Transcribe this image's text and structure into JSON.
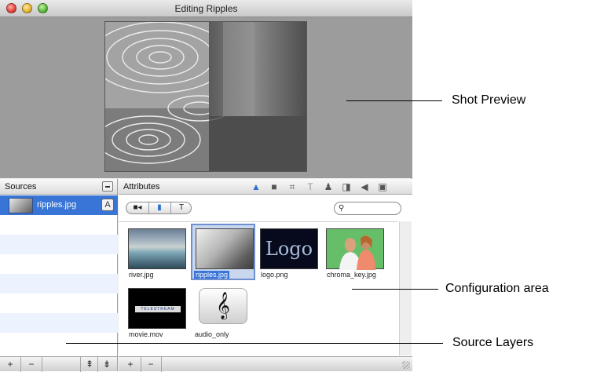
{
  "window": {
    "title": "Editing Ripples"
  },
  "sources": {
    "header": "Sources",
    "items": [
      {
        "name": "ripples.jpg",
        "badge": "A"
      }
    ],
    "bottom_buttons": [
      "+",
      "−",
      "⇞",
      "⇟"
    ]
  },
  "attributes": {
    "header": "Attributes",
    "segments": [
      "■◂",
      "▮",
      "T"
    ],
    "search_placeholder": "",
    "media": [
      {
        "name": "river.jpg",
        "selected": false
      },
      {
        "name": "ripples.jpg",
        "selected": true
      },
      {
        "name": "logo.png",
        "selected": false,
        "thumb_text": "Logo"
      },
      {
        "name": "chroma_key.jpg",
        "selected": false
      },
      {
        "name": "movie.mov",
        "selected": false,
        "thumb_text": "TELESTREAM"
      },
      {
        "name": "audio_only",
        "selected": false,
        "thumb_text": "𝄞"
      }
    ],
    "bottom_buttons": [
      "+",
      "−"
    ]
  },
  "callouts": {
    "shot_preview": "Shot Preview",
    "configuration_area": "Configuration area",
    "source_layers": "Source Layers"
  },
  "colors": {
    "selection": "#3875d7",
    "preview_background": "#9c9c9c"
  }
}
